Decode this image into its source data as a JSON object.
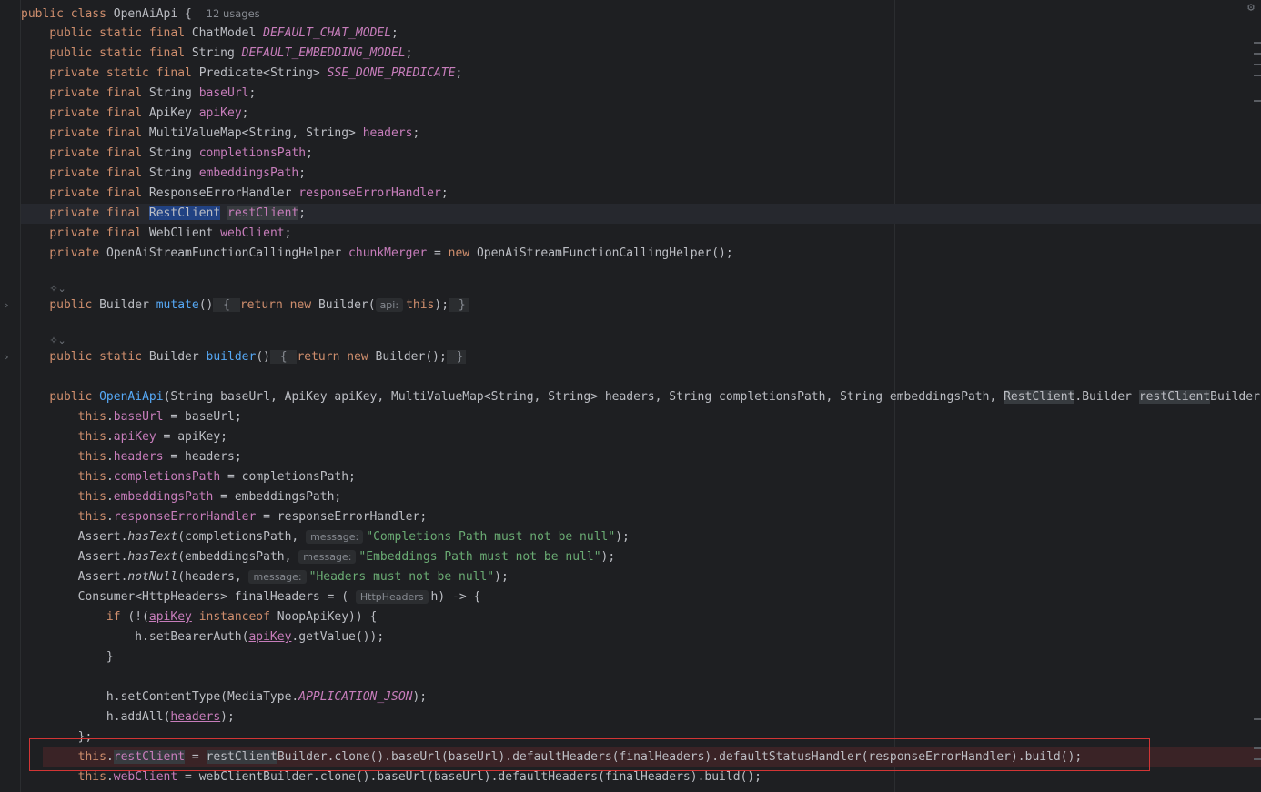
{
  "usages_hint": "12 usages",
  "param_hints": {
    "api": "api:",
    "message": "message:",
    "http_headers": "HttpHeaders"
  },
  "strings": {
    "completions": "\"Completions Path must not be null\"",
    "embeddings": "\"Embeddings Path must not be null\"",
    "headers": "\"Headers must not be null\""
  },
  "icons": {
    "settings": "gear-icon",
    "fold": "chevron-right-icon",
    "ai": "ai-assist-icon"
  }
}
